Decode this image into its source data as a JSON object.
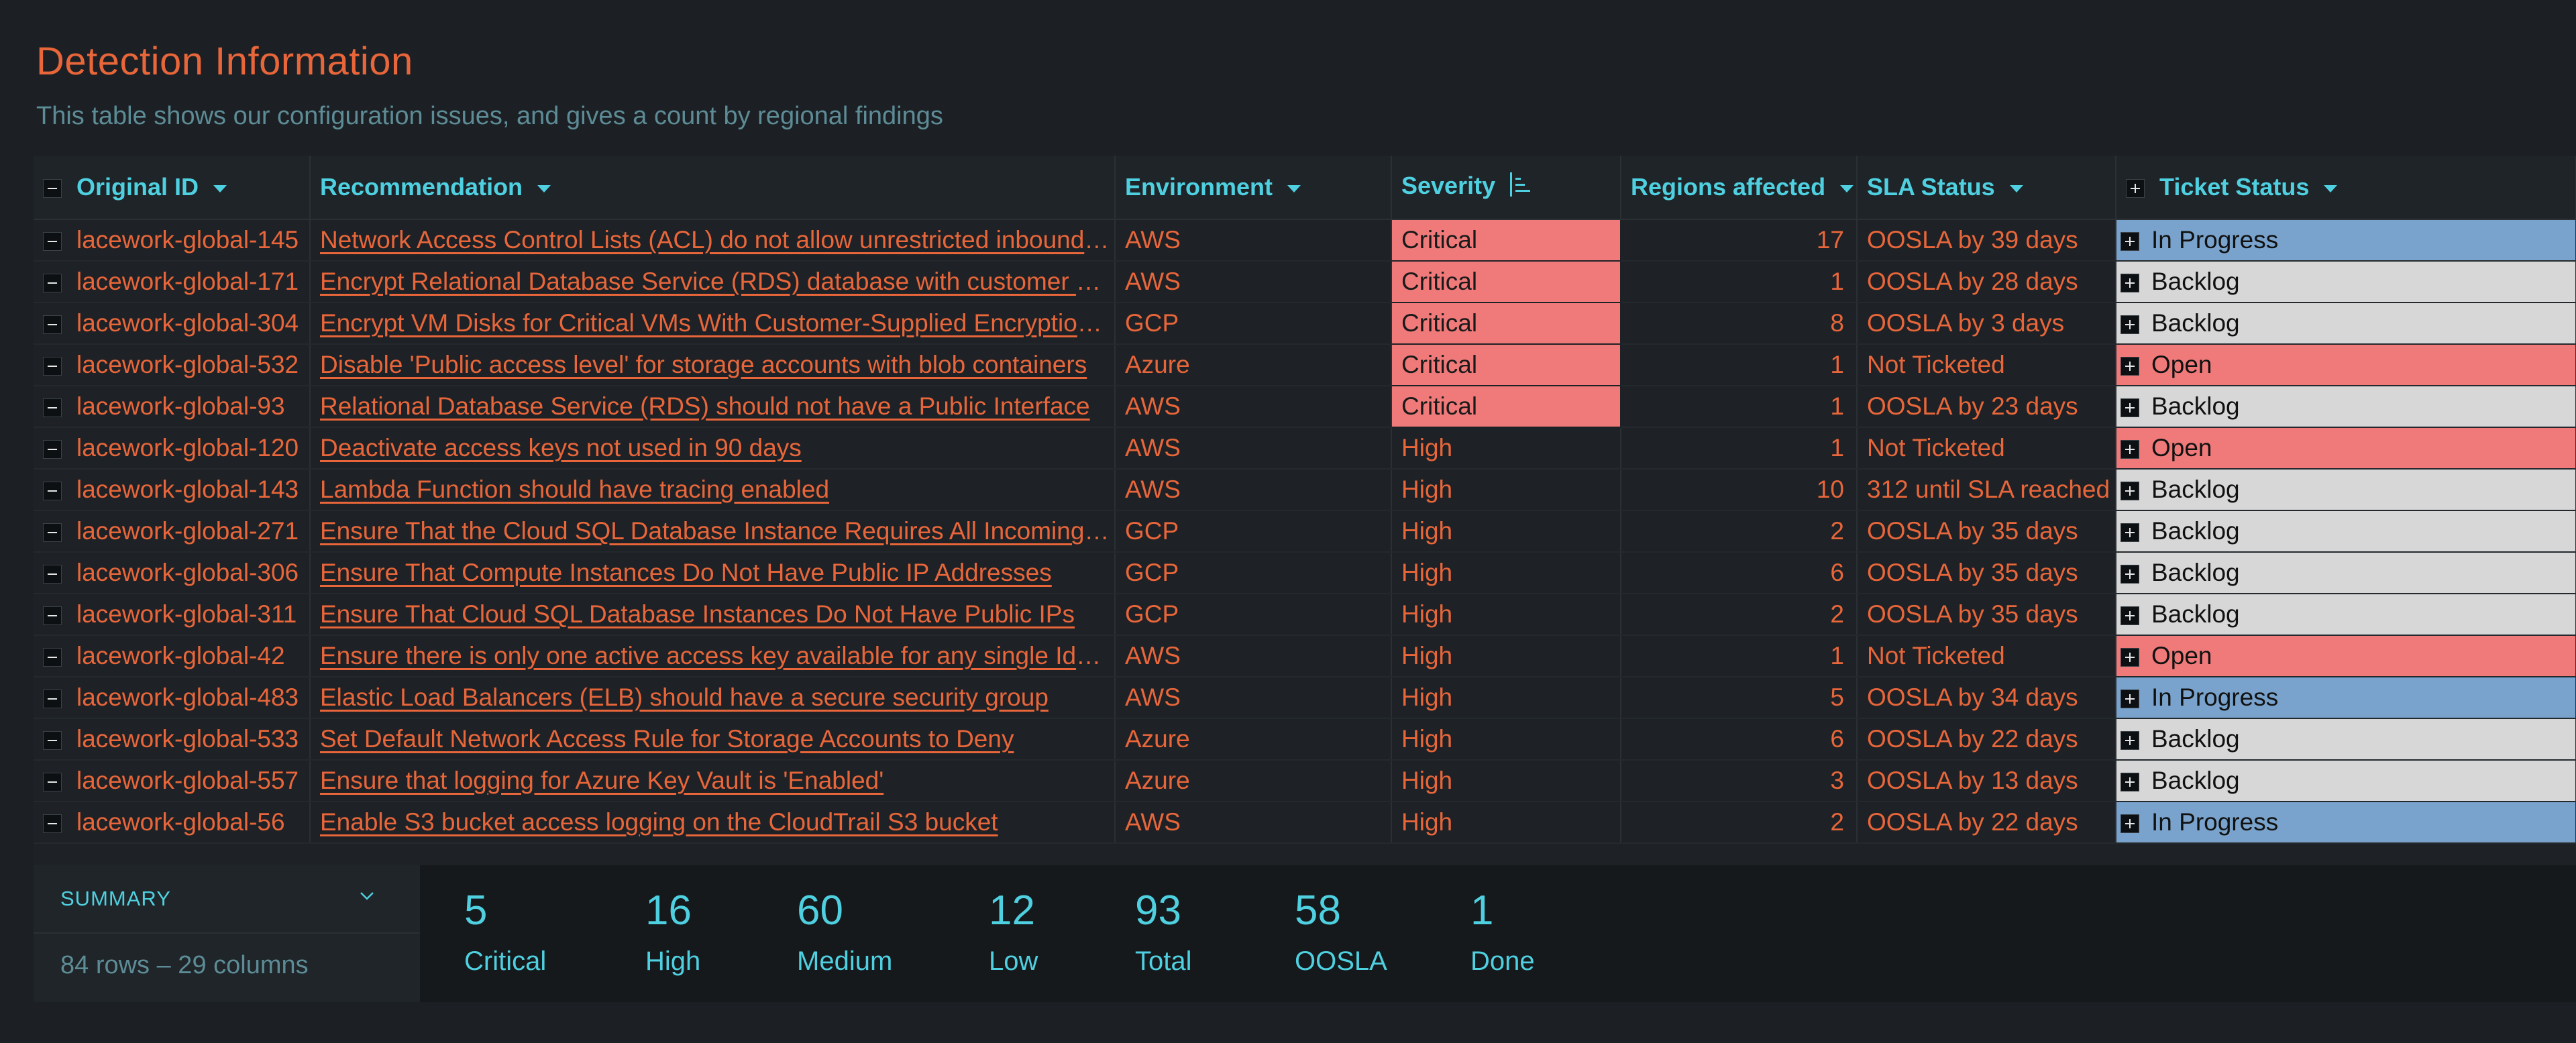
{
  "header": {
    "title": "Detection Information",
    "subtitle": "This table shows our configuration issues, and gives a count by regional findings"
  },
  "columns": [
    "Original ID",
    "Recommendation",
    "Environment",
    "Severity",
    "Regions affected",
    "SLA Status",
    "Ticket Status"
  ],
  "icons": {
    "collapse": "minus-box-icon",
    "expand": "plus-box-icon",
    "sort": "sort-bars-icon",
    "dropdown": "caret-down-icon",
    "chevron": "chevron-down-icon"
  },
  "colors": {
    "accent_orange": "#e8663a",
    "accent_cyan": "#4fd0e0",
    "critical_red": "#f07a7a",
    "in_progress_blue": "#79a3cc",
    "backlog_gray": "#d7d7d7"
  },
  "rows": [
    {
      "id": "lacework-global-145",
      "rec": "Network Access Control Lists (ACL) do not allow unrestricted inbound traffic",
      "env": "AWS",
      "sev": "Critical",
      "regions": "17",
      "sla": "OOSLA by 39 days",
      "ticket": "In Progress"
    },
    {
      "id": "lacework-global-171",
      "rec": "Encrypt Relational Database Service (RDS) database with customer managed keys",
      "env": "AWS",
      "sev": "Critical",
      "regions": "1",
      "sla": "OOSLA by 28 days",
      "ticket": "Backlog"
    },
    {
      "id": "lacework-global-304",
      "rec": "Encrypt VM Disks for Critical VMs With Customer-Supplied Encryption Keys",
      "env": "GCP",
      "sev": "Critical",
      "regions": "8",
      "sla": "OOSLA by 3 days",
      "ticket": "Backlog"
    },
    {
      "id": "lacework-global-532",
      "rec": "Disable 'Public access level' for storage accounts with blob containers",
      "env": "Azure",
      "sev": "Critical",
      "regions": "1",
      "sla": "Not Ticketed",
      "ticket": "Open"
    },
    {
      "id": "lacework-global-93",
      "rec": "Relational Database Service (RDS) should not have a Public Interface",
      "env": "AWS",
      "sev": "Critical",
      "regions": "1",
      "sla": "OOSLA by 23 days",
      "ticket": "Backlog"
    },
    {
      "id": "lacework-global-120",
      "rec": "Deactivate access keys not used in 90 days",
      "env": "AWS",
      "sev": "High",
      "regions": "1",
      "sla": "Not Ticketed",
      "ticket": "Open"
    },
    {
      "id": "lacework-global-143",
      "rec": "Lambda Function should have tracing enabled",
      "env": "AWS",
      "sev": "High",
      "regions": "10",
      "sla": "312 until SLA reached",
      "ticket": "Backlog"
    },
    {
      "id": "lacework-global-271",
      "rec": "Ensure That the Cloud SQL Database Instance Requires All Incoming Connections To Use SSL",
      "env": "GCP",
      "sev": "High",
      "regions": "2",
      "sla": "OOSLA by 35 days",
      "ticket": "Backlog"
    },
    {
      "id": "lacework-global-306",
      "rec": "Ensure That Compute Instances Do Not Have Public IP Addresses",
      "env": "GCP",
      "sev": "High",
      "regions": "6",
      "sla": "OOSLA by 35 days",
      "ticket": "Backlog"
    },
    {
      "id": "lacework-global-311",
      "rec": "Ensure That Cloud SQL Database Instances Do Not Have Public IPs",
      "env": "GCP",
      "sev": "High",
      "regions": "2",
      "sla": "OOSLA by 35 days",
      "ticket": "Backlog"
    },
    {
      "id": "lacework-global-42",
      "rec": "Ensure there is only one active access key available for any single Identity",
      "env": "AWS",
      "sev": "High",
      "regions": "1",
      "sla": "Not Ticketed",
      "ticket": "Open"
    },
    {
      "id": "lacework-global-483",
      "rec": "Elastic Load Balancers (ELB) should have a secure security group",
      "env": "AWS",
      "sev": "High",
      "regions": "5",
      "sla": "OOSLA by 34 days",
      "ticket": "In Progress"
    },
    {
      "id": "lacework-global-533",
      "rec": "Set Default Network Access Rule for Storage Accounts to Deny",
      "env": "Azure",
      "sev": "High",
      "regions": "6",
      "sla": "OOSLA by 22 days",
      "ticket": "Backlog"
    },
    {
      "id": "lacework-global-557",
      "rec": "Ensure that logging for Azure Key Vault is 'Enabled'",
      "env": "Azure",
      "sev": "High",
      "regions": "3",
      "sla": "OOSLA by 13 days",
      "ticket": "Backlog"
    },
    {
      "id": "lacework-global-56",
      "rec": "Enable S3 bucket access logging on the CloudTrail S3 bucket",
      "env": "AWS",
      "sev": "High",
      "regions": "2",
      "sla": "OOSLA by 22 days",
      "ticket": "In Progress"
    }
  ],
  "summary": {
    "label": "SUMMARY",
    "rows_info": "84 rows – 29 columns",
    "stats": [
      {
        "value": "5",
        "label": "Critical"
      },
      {
        "value": "16",
        "label": "High"
      },
      {
        "value": "60",
        "label": "Medium"
      },
      {
        "value": "12",
        "label": "Low"
      },
      {
        "value": "93",
        "label": "Total"
      },
      {
        "value": "58",
        "label": "OOSLA"
      },
      {
        "value": "1",
        "label": "Done"
      }
    ]
  }
}
